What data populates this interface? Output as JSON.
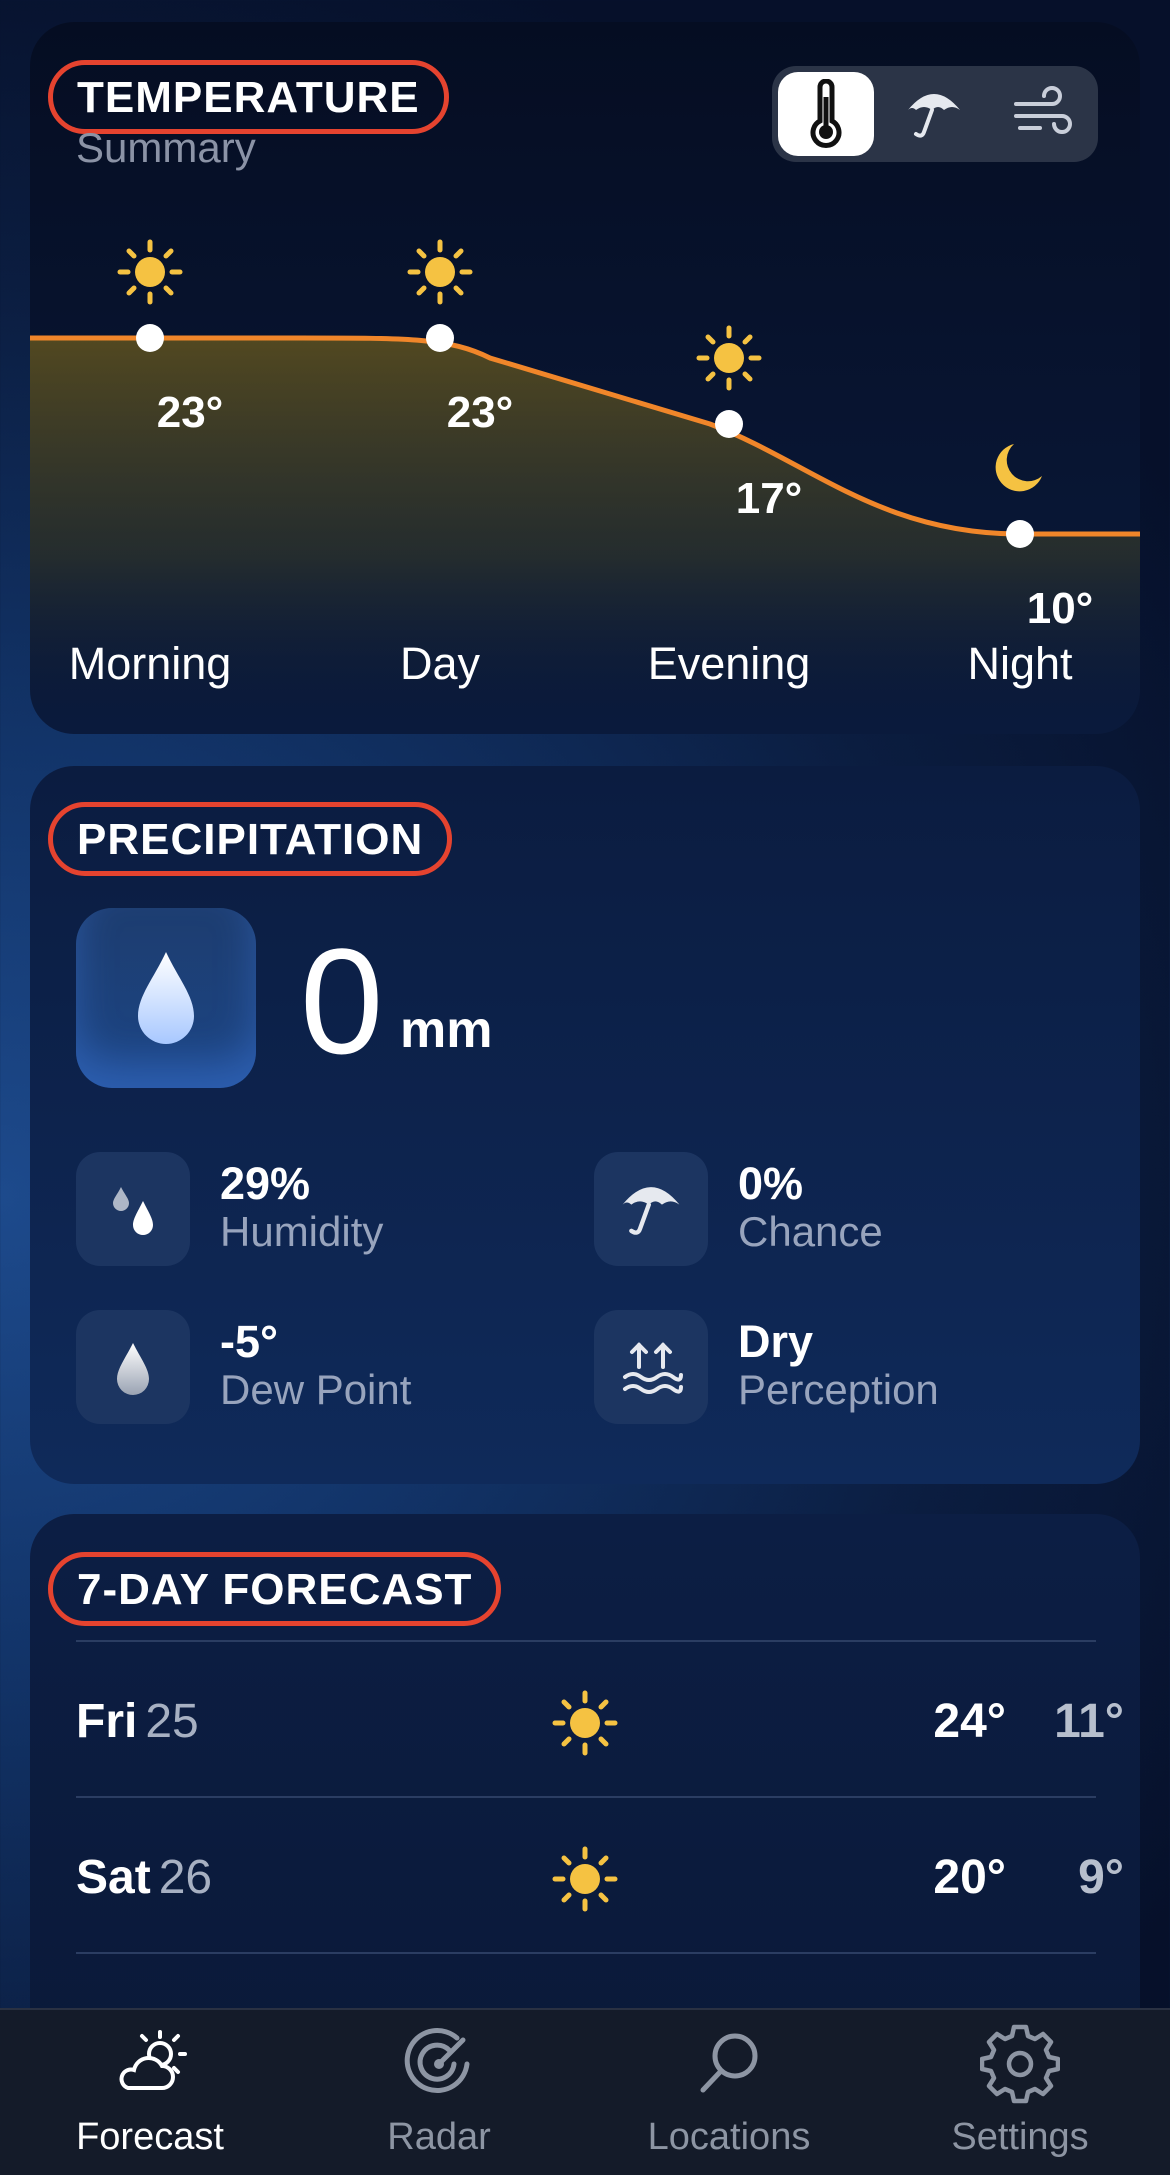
{
  "temperature": {
    "title": "TEMPERATURE",
    "subtitle": "Summary",
    "segments": [
      {
        "icon": "thermometer-icon",
        "active": true
      },
      {
        "icon": "umbrella-icon",
        "active": false
      },
      {
        "icon": "wind-icon",
        "active": false
      }
    ],
    "periods": [
      {
        "label": "Morning",
        "temp": "23°",
        "icon": "sun-icon"
      },
      {
        "label": "Day",
        "temp": "23°",
        "icon": "sun-icon"
      },
      {
        "label": "Evening",
        "temp": "17°",
        "icon": "sun-icon"
      },
      {
        "label": "Night",
        "temp": "10°",
        "icon": "moon-icon"
      }
    ],
    "colors": {
      "line": "#f0862a",
      "sun": "#f5c242",
      "moon": "#f5c242"
    }
  },
  "precipitation": {
    "title": "PRECIPITATION",
    "amount": "0",
    "unit": "mm",
    "stats": [
      {
        "value": "29%",
        "label": "Humidity",
        "icon": "droplets-icon"
      },
      {
        "value": "0%",
        "label": "Chance",
        "icon": "umbrella-icon"
      },
      {
        "value": "-5°",
        "label": "Dew Point",
        "icon": "droplet-icon"
      },
      {
        "value": "Dry",
        "label": "Perception",
        "icon": "evaporation-icon"
      }
    ]
  },
  "forecast": {
    "title": "7-DAY FORECAST",
    "days": [
      {
        "day": "Fri",
        "date": "25",
        "icon": "sun-icon",
        "high": "24°",
        "low": "11°"
      },
      {
        "day": "Sat",
        "date": "26",
        "icon": "sun-icon",
        "high": "20°",
        "low": "9°"
      }
    ]
  },
  "tabs": [
    {
      "label": "Forecast",
      "icon": "partly-sunny-icon",
      "active": true
    },
    {
      "label": "Radar",
      "icon": "radar-icon",
      "active": false
    },
    {
      "label": "Locations",
      "icon": "search-icon",
      "active": false
    },
    {
      "label": "Settings",
      "icon": "gear-icon",
      "active": false
    }
  ]
}
